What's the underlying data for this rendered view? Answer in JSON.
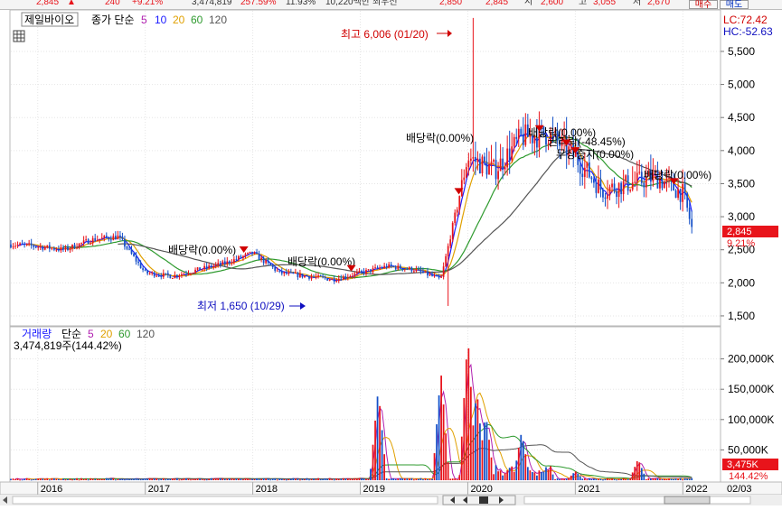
{
  "quote_bar": {
    "price": "2,845",
    "direction": "▲",
    "change": "240",
    "change_pct": "+9.21%",
    "volume": "3,474,819",
    "volume_ratio": "257.59%",
    "turnover_rate": "11.93%",
    "amount": "10,220백만",
    "prev_close_label": "최우선",
    "ask": "2,850",
    "bid": "2,845",
    "open_label": "시",
    "open": "2,600",
    "high_label": "고",
    "high": "3,055",
    "low_label": "저",
    "low": "2,670",
    "buy_label": "매수",
    "sell_label": "매도"
  },
  "price_panel": {
    "stock_name": "제일바이오",
    "ma_label": "종가 단순",
    "ma_periods": [
      "5",
      "10",
      "20",
      "60",
      "120"
    ],
    "lc_label": "LC:72.42",
    "hc_label": "HC:-52.63",
    "current_price_tag": "2,845",
    "current_change_tag": "9.21%",
    "high_annotation": "최고 6,006 (01/20)",
    "low_annotation": "최저 1,650 (10/29)",
    "events": [
      "배당락(0.00%)",
      "배당락(0.00%)",
      "배당락(0.00%)",
      "배당락(0.00%)",
      "권리락(-48.45%)",
      "무상증자(0.00%)",
      "배당락(0.00%)"
    ]
  },
  "volume_panel": {
    "label": "거래량",
    "ma_label": "단순",
    "ma_periods": [
      "5",
      "20",
      "60",
      "120"
    ],
    "readout": "3,474,819주(144.42%)",
    "current_volume_tag": "3,475K",
    "current_pct_tag": "144.42%"
  },
  "date_axis": {
    "labels": [
      "2016",
      "2017",
      "2018",
      "2019",
      "2020",
      "2021",
      "2022"
    ],
    "right_label": "02/03"
  },
  "colors": {
    "up": "#e8141b",
    "down": "#1450c8",
    "ma5": "#b020b0",
    "ma10": "#1a1aff",
    "ma20": "#e0a000",
    "ma60": "#2e9a2e",
    "ma120": "#555555",
    "annotation_red": "#d00000",
    "annotation_blue": "#1010c0"
  },
  "chart_data": [
    {
      "type": "candlestick",
      "title": "제일바이오",
      "x_range": [
        "2015-09",
        "2022-02-03"
      ],
      "ylim": [
        1500,
        6100
      ],
      "y_ticks": [
        1500,
        2000,
        2500,
        3000,
        3500,
        4000,
        4500,
        5000,
        5500
      ],
      "y_tick_labels": [
        "1,500",
        "2,000",
        "2,500",
        "3,000",
        "3,500",
        "4,000",
        "4,500",
        "5,000",
        "5,500"
      ],
      "x": [
        "2015-10",
        "2016-01",
        "2016-04",
        "2016-07",
        "2016-10",
        "2017-01",
        "2017-04",
        "2017-07",
        "2017-10",
        "2018-01",
        "2018-04",
        "2018-07",
        "2018-10",
        "2019-01",
        "2019-04",
        "2019-07",
        "2019-10",
        "2020-01",
        "2020-04",
        "2020-07",
        "2020-10",
        "2021-01",
        "2021-04",
        "2021-07",
        "2021-10",
        "2022-01",
        "2022-02"
      ],
      "close": [
        2580,
        2550,
        2500,
        2650,
        2700,
        2150,
        2100,
        2200,
        2300,
        2450,
        2150,
        2100,
        2050,
        2150,
        2250,
        2200,
        2050,
        3900,
        3700,
        4200,
        4250,
        3900,
        3400,
        3500,
        3600,
        3350,
        2845
      ],
      "events": [
        {
          "date": "2017-12",
          "label": "배당락(0.00%)"
        },
        {
          "date": "2018-12",
          "label": "배당락(0.00%)"
        },
        {
          "date": "2019-12",
          "label": "배당락(0.00%)"
        },
        {
          "date": "2020-09",
          "label": "배당락(0.00%)"
        },
        {
          "date": "2020-12",
          "label": "권리락(-48.45%)"
        },
        {
          "date": "2021-01",
          "label": "무상증자(0.00%)"
        },
        {
          "date": "2021-12",
          "label": "배당락(0.00%)"
        }
      ],
      "max": {
        "value": 6006,
        "date": "01/20"
      },
      "min": {
        "value": 1650,
        "date": "10/29"
      },
      "last": {
        "value": 2845,
        "change_pct": "9.21%"
      }
    },
    {
      "type": "bar",
      "title": "거래량",
      "ylim": [
        0,
        250000
      ],
      "y_ticks": [
        50000,
        100000,
        150000,
        200000
      ],
      "y_tick_labels": [
        "50,000K",
        "100,000K",
        "150,000K",
        "200,000K"
      ],
      "x": [
        "2016",
        "2017",
        "2018",
        "2019",
        "2019-03",
        "2019-10",
        "2020-01",
        "2020-02",
        "2020-03",
        "2020-07",
        "2021-01",
        "2021-08",
        "2022-02"
      ],
      "values": [
        3000,
        3000,
        2000,
        4000,
        150000,
        180000,
        240000,
        150000,
        110000,
        80000,
        15000,
        35000,
        3475
      ]
    }
  ]
}
